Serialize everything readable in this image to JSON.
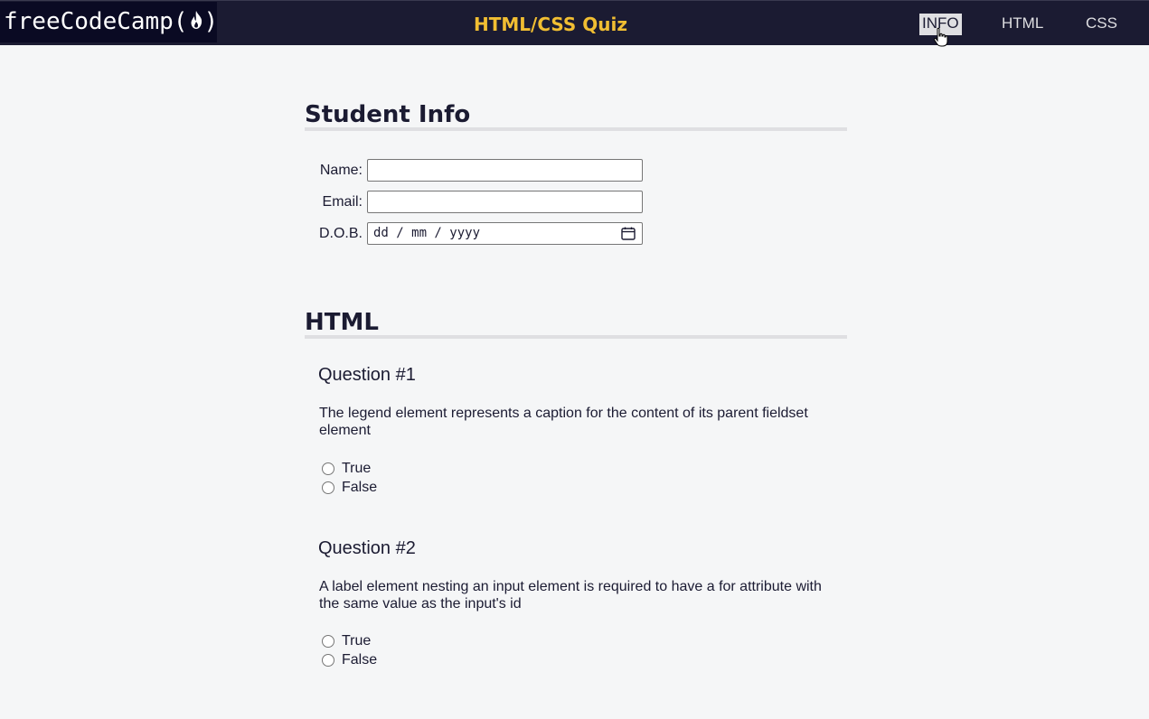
{
  "header": {
    "logo_text": "freeCodeCamp(",
    "logo_close": ")",
    "title": "HTML/CSS Quiz",
    "nav": [
      {
        "label": "INFO",
        "active": true
      },
      {
        "label": "HTML",
        "active": false
      },
      {
        "label": "CSS",
        "active": false
      }
    ]
  },
  "student_info": {
    "heading": "Student Info",
    "fields": [
      {
        "label": "Name:",
        "value": ""
      },
      {
        "label": "Email:",
        "value": ""
      },
      {
        "label": "D.O.B.",
        "placeholder": "dd / mm / yyyy"
      }
    ]
  },
  "html_section": {
    "heading": "HTML",
    "questions": [
      {
        "title": "Question #1",
        "text": "The legend element represents a caption for the content of its parent fieldset element",
        "options": [
          "True",
          "False"
        ]
      },
      {
        "title": "Question #2",
        "text": "A label element nesting an input element is required to have a for attribute with the same value as the input's id",
        "options": [
          "True",
          "False"
        ]
      }
    ]
  },
  "colors": {
    "topbar": "#1b1b32",
    "logo_bg": "#0a0a23",
    "title_accent": "#f1be32",
    "page_bg": "#f5f6f7",
    "rule": "#dfdfe2"
  },
  "icons": [
    "fire-icon",
    "calendar-icon",
    "pointer-cursor-icon"
  ]
}
